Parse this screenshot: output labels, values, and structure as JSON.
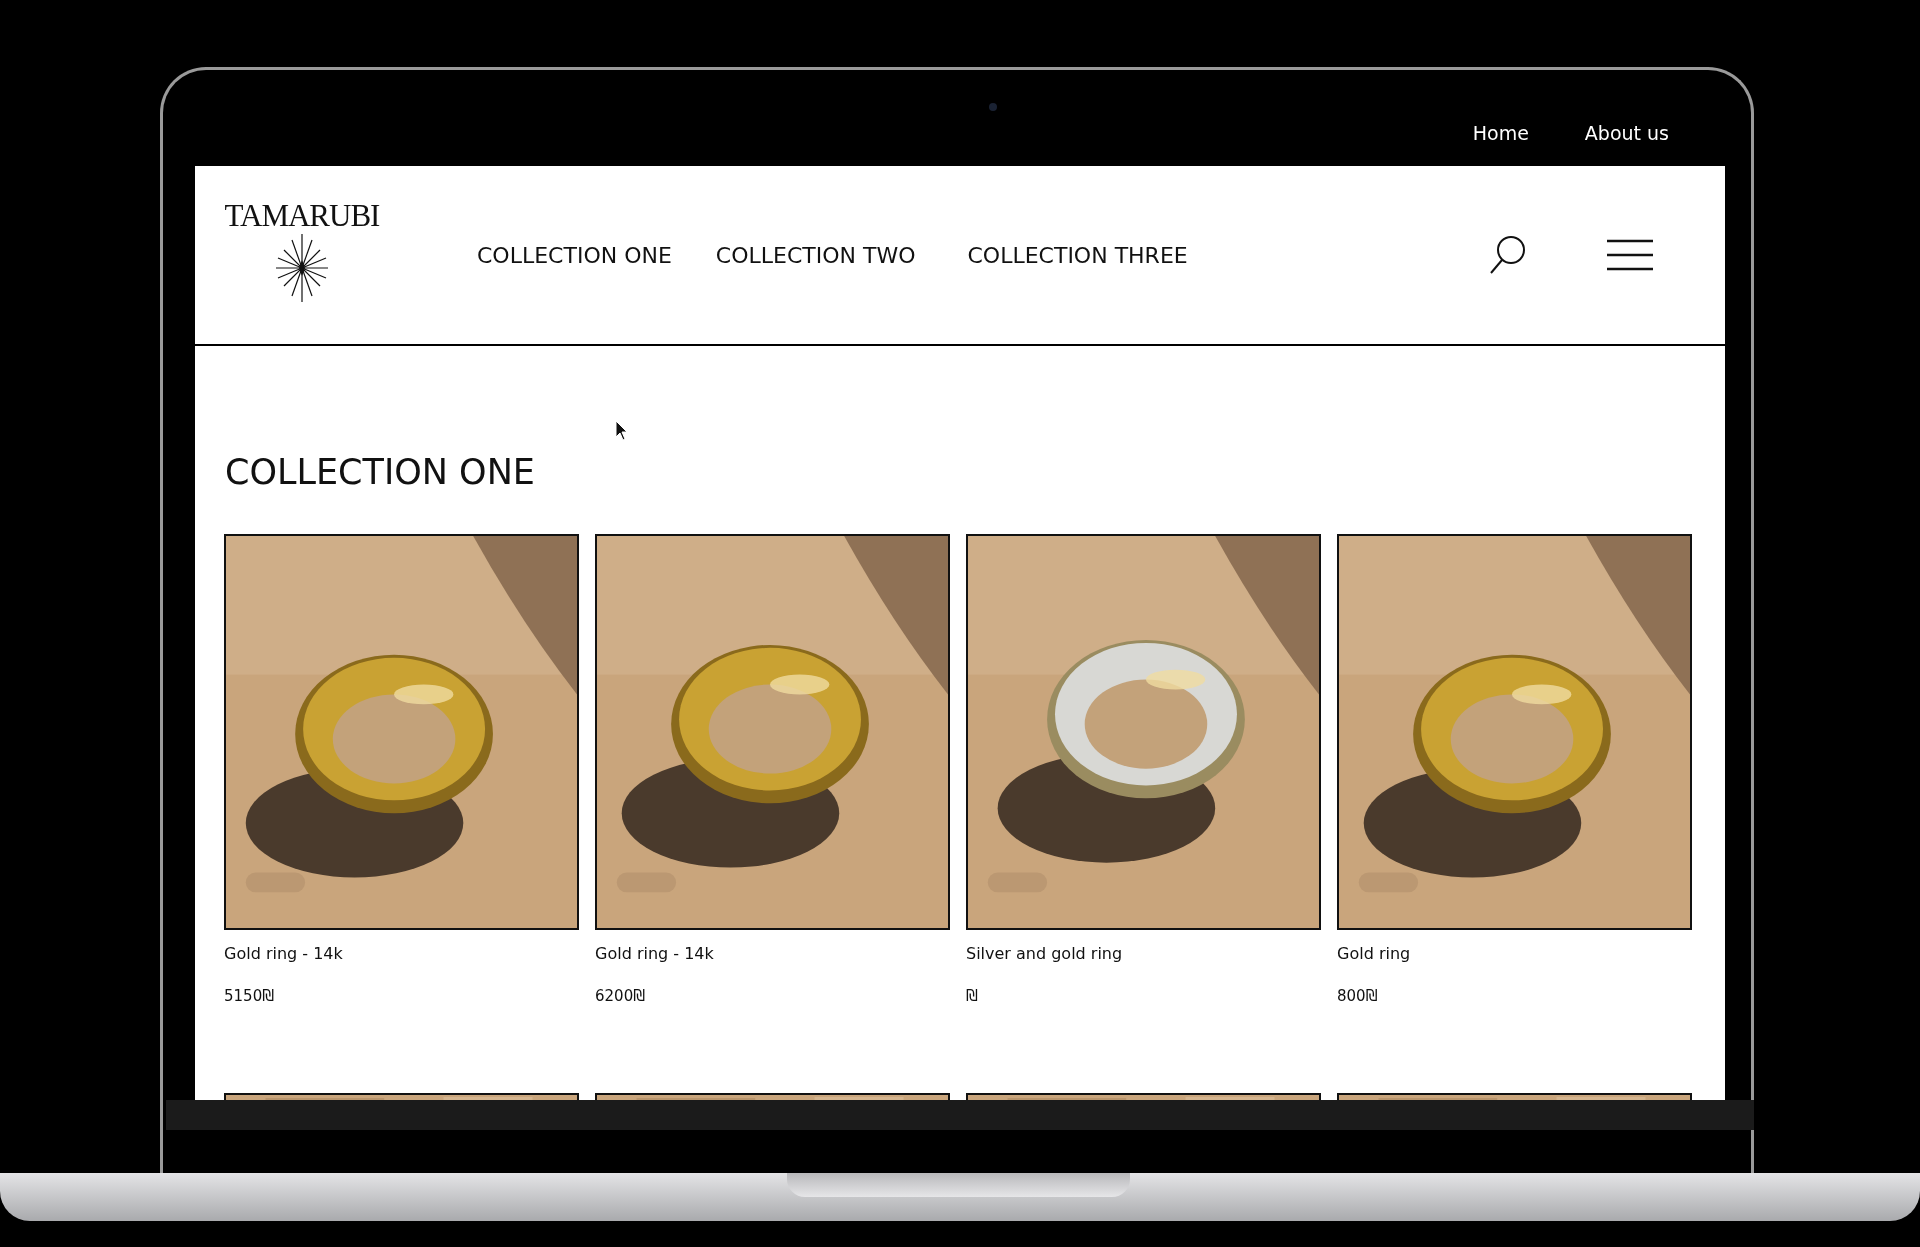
{
  "top_links": [
    {
      "label": "Home"
    },
    {
      "label": "About us"
    }
  ],
  "logo": {
    "text": "TAMARUBI"
  },
  "nav": [
    {
      "label": "COLLECTION ONE"
    },
    {
      "label": "COLLECTION TWO"
    },
    {
      "label": "COLLECTION THREE"
    }
  ],
  "heading": "COLLECTION ONE",
  "products": [
    {
      "name": "Gold ring - 14k",
      "price": "5150₪",
      "kind": "gold"
    },
    {
      "name": "Gold ring - 14k",
      "price": "6200₪",
      "kind": "gold"
    },
    {
      "name": "Silver and gold ring",
      "price": "₪",
      "kind": "silver"
    },
    {
      "name": "Gold ring",
      "price": "800₪",
      "kind": "gold"
    }
  ]
}
